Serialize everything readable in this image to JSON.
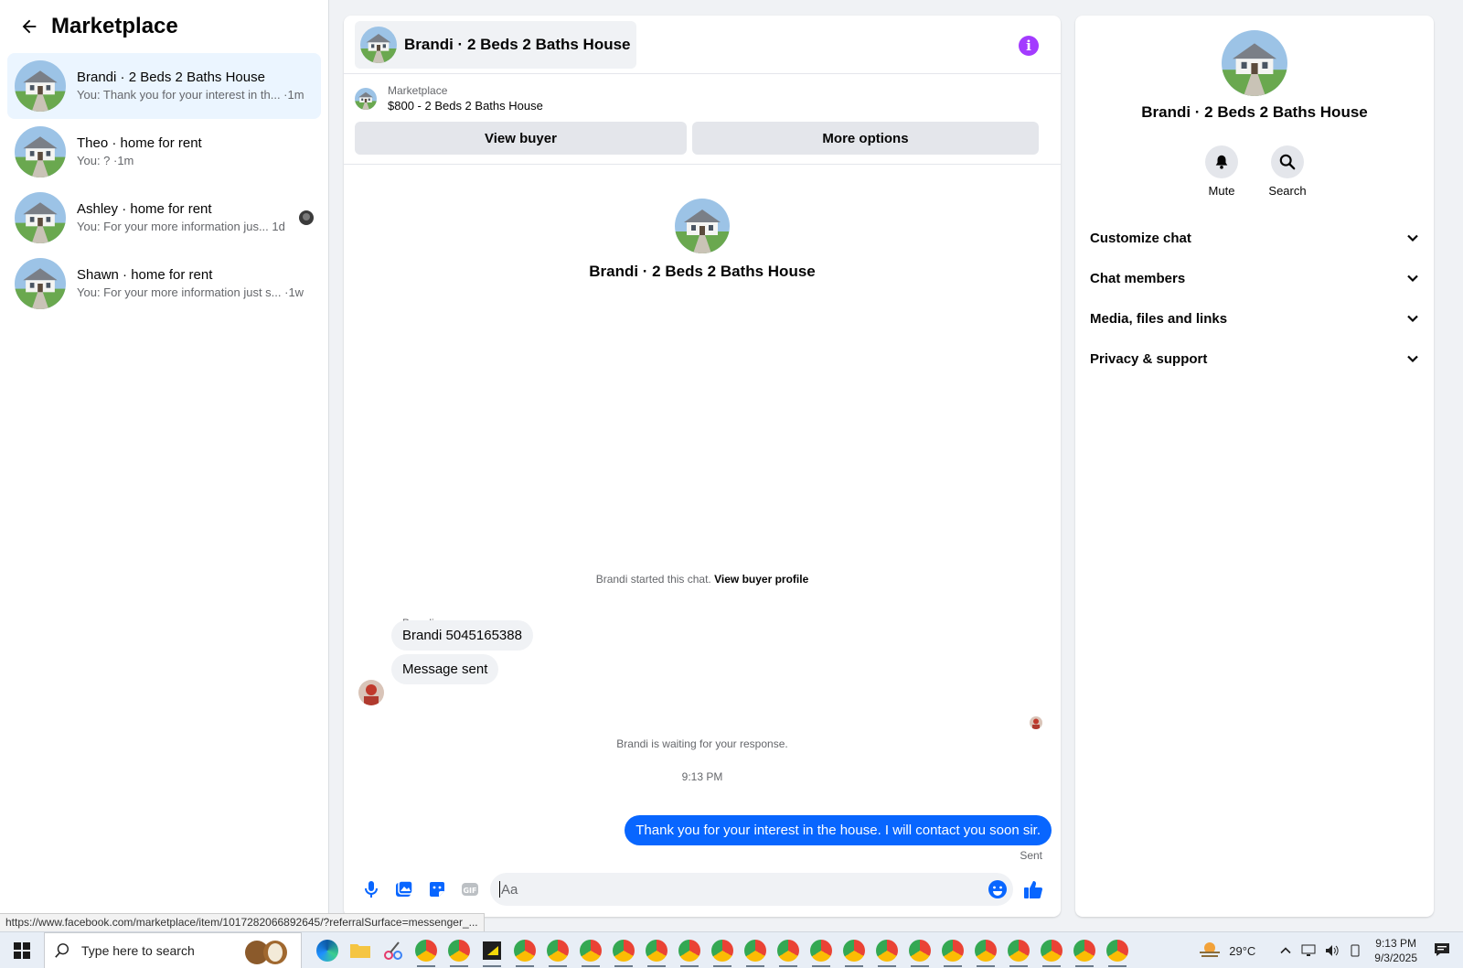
{
  "sidebar": {
    "title": "Marketplace",
    "conversations": [
      {
        "name": "Brandi · 2 Beds 2 Baths House",
        "preview": "You: Thank you for your interest in th... ·1m"
      },
      {
        "name": "Theo · home for rent",
        "preview": "You: ? ·1m"
      },
      {
        "name": "Ashley · home for rent",
        "preview": "You: For your more information jus...  1d"
      },
      {
        "name": "Shawn · home for rent",
        "preview": "You: For your more information just s... ·1w"
      }
    ]
  },
  "chat": {
    "title": "Brandi · 2 Beds 2 Baths House",
    "listing_source": "Marketplace",
    "listing_title": "$800 - 2 Beds 2 Baths House",
    "view_buyer": "View buyer",
    "more_options": "More options",
    "intro_name": "Brandi · 2 Beds 2 Baths House",
    "started_text": "Brandi started this chat.",
    "view_buyer_profile": "View buyer profile",
    "sender_name": "Brandi",
    "msg1": "Brandi 5045165388",
    "msg2": "Message sent",
    "waiting_text": "Brandi is waiting for your response.",
    "timestamp": "9:13 PM",
    "outgoing": "Thank you for your interest in the house. I will contact you soon sir.",
    "sent_label": "Sent",
    "input_placeholder": "Aa"
  },
  "details": {
    "name": "Brandi · 2 Beds 2 Baths House",
    "mute": "Mute",
    "search": "Search",
    "sections": [
      "Customize chat",
      "Chat members",
      "Media, files and links",
      "Privacy & support"
    ]
  },
  "status_url": "https://www.facebook.com/marketplace/item/1017282066892645/?referralSurface=messenger_...",
  "taskbar": {
    "search_placeholder": "Type here to search",
    "temperature": "29°C",
    "time": "9:13 PM",
    "date": "9/3/2025"
  },
  "colors": {
    "accent": "#0866ff",
    "info": "#a33bff"
  }
}
